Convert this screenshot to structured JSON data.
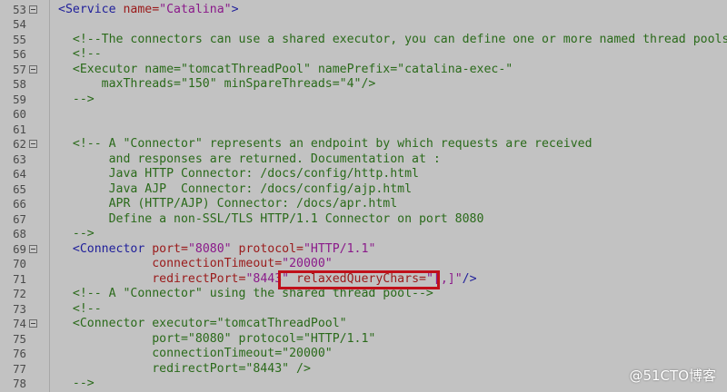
{
  "lines": [
    {
      "n": "53",
      "fold": true,
      "tokens": [
        [
          "t",
          "<Service "
        ],
        [
          "a",
          "name="
        ],
        [
          "v",
          "\"Catalina\""
        ],
        [
          "t",
          ">"
        ]
      ],
      "indent": ""
    },
    {
      "n": "54",
      "fold": false,
      "tokens": [],
      "indent": ""
    },
    {
      "n": "55",
      "fold": false,
      "tokens": [
        [
          "c",
          "<!--The connectors can use a shared executor, you can define one or more named thread pools-->"
        ]
      ],
      "indent": "  "
    },
    {
      "n": "56",
      "fold": false,
      "tokens": [
        [
          "c",
          "<!--"
        ]
      ],
      "indent": "  "
    },
    {
      "n": "57",
      "fold": true,
      "tokens": [
        [
          "c",
          "<Executor name=\"tomcatThreadPool\" namePrefix=\"catalina-exec-\""
        ]
      ],
      "indent": "  "
    },
    {
      "n": "58",
      "fold": false,
      "tokens": [
        [
          "c",
          "maxThreads=\"150\" minSpareThreads=\"4\"/>"
        ]
      ],
      "indent": "      "
    },
    {
      "n": "59",
      "fold": false,
      "tokens": [
        [
          "c",
          "-->"
        ]
      ],
      "indent": "  "
    },
    {
      "n": "60",
      "fold": false,
      "tokens": [],
      "indent": ""
    },
    {
      "n": "61",
      "fold": false,
      "tokens": [],
      "indent": ""
    },
    {
      "n": "62",
      "fold": true,
      "tokens": [
        [
          "c",
          "<!-- A \"Connector\" represents an endpoint by which requests are received"
        ]
      ],
      "indent": "  "
    },
    {
      "n": "63",
      "fold": false,
      "tokens": [
        [
          "c",
          "and responses are returned. Documentation at :"
        ]
      ],
      "indent": "       "
    },
    {
      "n": "64",
      "fold": false,
      "tokens": [
        [
          "c",
          "Java HTTP Connector: /docs/config/http.html"
        ]
      ],
      "indent": "       "
    },
    {
      "n": "65",
      "fold": false,
      "tokens": [
        [
          "c",
          "Java AJP  Connector: /docs/config/ajp.html"
        ]
      ],
      "indent": "       "
    },
    {
      "n": "66",
      "fold": false,
      "tokens": [
        [
          "c",
          "APR (HTTP/AJP) Connector: /docs/apr.html"
        ]
      ],
      "indent": "       "
    },
    {
      "n": "67",
      "fold": false,
      "tokens": [
        [
          "c",
          "Define a non-SSL/TLS HTTP/1.1 Connector on port 8080"
        ]
      ],
      "indent": "       "
    },
    {
      "n": "68",
      "fold": false,
      "tokens": [
        [
          "c",
          "-->"
        ]
      ],
      "indent": "  "
    },
    {
      "n": "69",
      "fold": true,
      "tokens": [
        [
          "t",
          "<Connector "
        ],
        [
          "a",
          "port="
        ],
        [
          "v",
          "\"8080\""
        ],
        [
          "a",
          " protocol="
        ],
        [
          "v",
          "\"HTTP/1.1\""
        ]
      ],
      "indent": "  "
    },
    {
      "n": "70",
      "fold": false,
      "tokens": [
        [
          "a",
          "connectionTimeout="
        ],
        [
          "v",
          "\"20000\""
        ]
      ],
      "indent": "             "
    },
    {
      "n": "71",
      "fold": false,
      "tokens": [
        [
          "a",
          "redirectPort="
        ],
        [
          "v",
          "\"8443\""
        ],
        [
          "x",
          " "
        ],
        [
          "a",
          "relaxedQueryChars="
        ],
        [
          "v",
          "\"[,]\""
        ],
        [
          "t",
          "/>"
        ]
      ],
      "indent": "             "
    },
    {
      "n": "72",
      "fold": false,
      "tokens": [
        [
          "c",
          "<!-- A \"Connector\" using the shared thread pool-->"
        ]
      ],
      "indent": "  "
    },
    {
      "n": "73",
      "fold": false,
      "tokens": [
        [
          "c",
          "<!--"
        ]
      ],
      "indent": "  "
    },
    {
      "n": "74",
      "fold": true,
      "tokens": [
        [
          "c",
          "<Connector executor=\"tomcatThreadPool\""
        ]
      ],
      "indent": "  "
    },
    {
      "n": "75",
      "fold": false,
      "tokens": [
        [
          "c",
          "port=\"8080\" protocol=\"HTTP/1.1\""
        ]
      ],
      "indent": "             "
    },
    {
      "n": "76",
      "fold": false,
      "tokens": [
        [
          "c",
          "connectionTimeout=\"20000\""
        ]
      ],
      "indent": "             "
    },
    {
      "n": "77",
      "fold": false,
      "tokens": [
        [
          "c",
          "redirectPort=\"8443\" />"
        ]
      ],
      "indent": "             "
    },
    {
      "n": "78",
      "fold": false,
      "tokens": [
        [
          "c",
          "-->"
        ]
      ],
      "indent": "  "
    }
  ],
  "watermark": "@51CTO博客",
  "colors": {
    "highlight_box": "#c0101a",
    "background": "#c2c2c2"
  }
}
